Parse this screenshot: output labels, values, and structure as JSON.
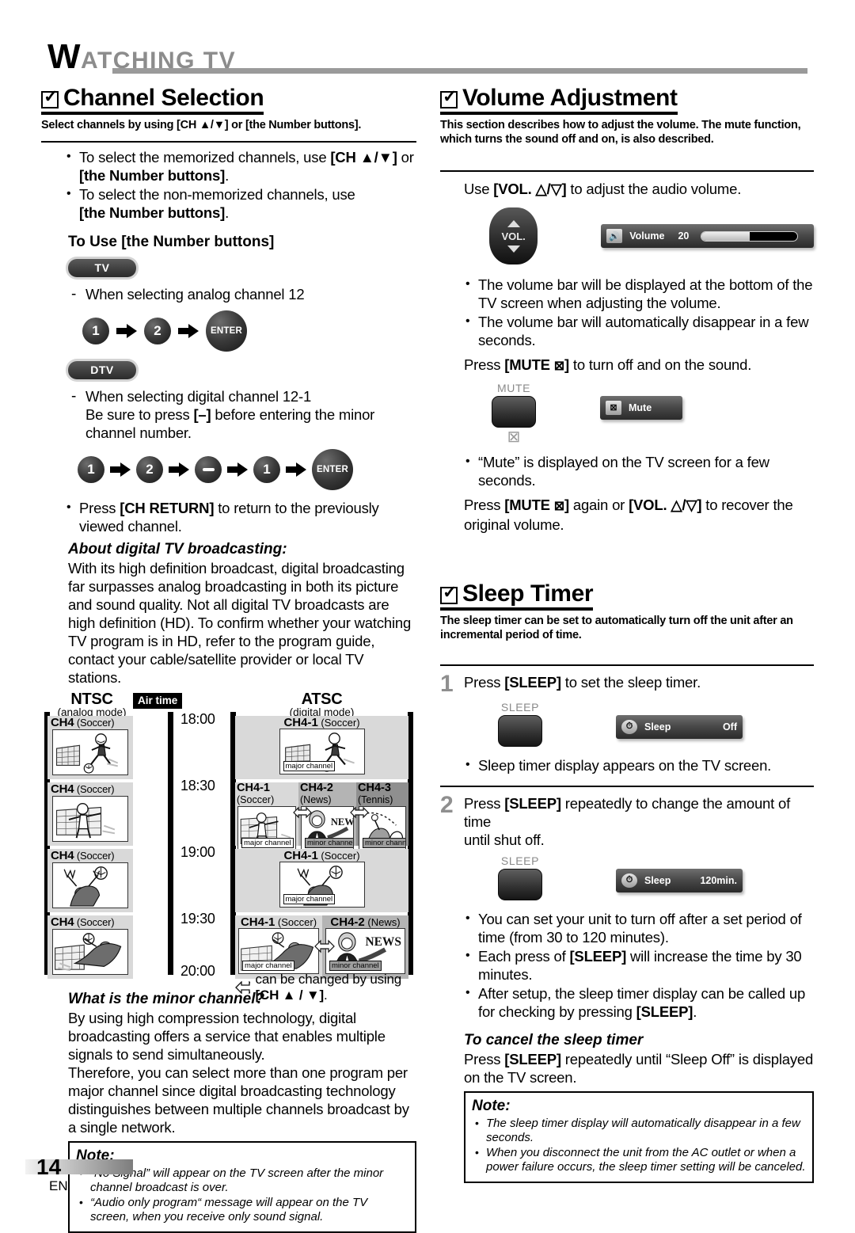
{
  "header": {
    "title_cap": "W",
    "title_rest": "ATCHING TV"
  },
  "footer": {
    "page_number": "14",
    "lang": "EN"
  },
  "channel_selection": {
    "heading": "Channel Selection",
    "subheading": "Select channels by using [CH ▲/▼] or [the Number buttons].",
    "bullets": [
      "To select the memorized channels, use [CH ▲/▼] or [the Number buttons].",
      "To select the non-memorized channels, use [the Number buttons]."
    ],
    "use_number_heading": "To Use [the Number buttons]",
    "tv_pill": "TV",
    "dtv_pill": "DTV",
    "analog_line": "When selecting analog channel 12",
    "analog_keys": [
      "1",
      "2",
      "ENTER"
    ],
    "digital_line_1": "When selecting digital channel 12-1",
    "digital_line_2": "Be sure to press [–] before entering the minor channel number.",
    "digital_keys": [
      "1",
      "2",
      "−",
      "1",
      "ENTER"
    ],
    "ch_return_bullet": "Press [CH RETURN] to return to the previously viewed channel.",
    "about_heading": "About digital TV broadcasting:",
    "about_body": "With its high definition broadcast, digital broadcasting far surpasses analog broadcasting in both its picture and sound quality. Not all digital TV broadcasts are high definition (HD). To confirm whether your watching TV program is in HD, refer to the program guide, contact your cable/satellite provider or local TV stations.",
    "minor_heading": "What is the minor channel?",
    "minor_body_1": "By using high compression technology, digital broadcasting offers a service that enables multiple signals to send simultaneously.",
    "minor_body_2": "Therefore, you can select more than one program per major channel since digital broadcasting technology distinguishes between multiple channels broadcast by a single network.",
    "note": {
      "title": "Note:",
      "items": [
        "“No Signal” will appear on the TV screen after the minor channel broadcast is over.",
        "“Audio only program“ message will appear on the TV screen, when you receive only sound signal."
      ]
    }
  },
  "broadcast_figure": {
    "ntsc_title": "NTSC",
    "ntsc_sub": "(analog mode)",
    "atsc_title": "ATSC",
    "atsc_sub": "(digital mode)",
    "airtime_label": "Air time",
    "times": [
      "18:00",
      "18:30",
      "19:00",
      "19:30",
      "20:00"
    ],
    "ntsc_cells": [
      {
        "ch": "CH4",
        "prog": "(Soccer)"
      },
      {
        "ch": "CH4",
        "prog": "(Soccer)"
      },
      {
        "ch": "CH4",
        "prog": "(Soccer)"
      },
      {
        "ch": "CH4",
        "prog": "(Soccer)"
      }
    ],
    "atsc_rows": [
      {
        "cells": [
          {
            "ch": "CH4-1",
            "prog": "(Soccer)",
            "tag": "major channel"
          }
        ]
      },
      {
        "cells": [
          {
            "ch": "CH4-1",
            "prog": "(Soccer)",
            "tag": "major channel"
          },
          {
            "ch": "CH4-2",
            "prog": "(News)",
            "tag": "minor channel"
          },
          {
            "ch": "CH4-3",
            "prog": "(Tennis)",
            "tag": "minor channel"
          }
        ]
      },
      {
        "cells": [
          {
            "ch": "CH4-1",
            "prog": "(Soccer)",
            "tag": "major channel"
          }
        ]
      },
      {
        "cells": [
          {
            "ch": "CH4-1",
            "prog": "(Soccer)",
            "tag": "major channel"
          },
          {
            "ch": "CH4-2",
            "prog": "(News)",
            "tag": "minor channel"
          }
        ]
      }
    ],
    "legend": "can be changed by using [CH ▲ / ▼]."
  },
  "volume_adjustment": {
    "heading": "Volume Adjustment",
    "subheading": "This section describes how to adjust the volume. The mute function, which turns the sound off and on, is also described.",
    "use_line": "Use [VOL. △/▽] to adjust the audio volume.",
    "vol_key_label": "VOL.",
    "osd_volume": {
      "icon": "speaker-icon",
      "label": "Volume",
      "value": "20",
      "fill_percent": 50
    },
    "bullets": [
      "The volume bar will be displayed at the bottom of the TV screen when adjusting the volume.",
      "The volume bar will automatically disappear in a few seconds."
    ],
    "mute_line": "Press [MUTE ⊠] to turn off and on the sound.",
    "mute_key_caption": "MUTE",
    "osd_mute": {
      "icon": "mute-icon",
      "label": "Mute"
    },
    "mute_bullet": "“Mute” is displayed on the TV screen for a few seconds.",
    "recover_line": "Press [MUTE ⊠] again or [VOL. △/▽] to recover the original volume."
  },
  "sleep_timer": {
    "heading": "Sleep Timer",
    "subheading": "The sleep timer can be set to automatically turn off the unit after an incremental period of time.",
    "step1": {
      "num": "1",
      "text": "Press [SLEEP] to set the sleep timer.",
      "key_caption": "SLEEP",
      "osd": {
        "icon": "clock-icon",
        "label": "Sleep",
        "value": "Off"
      },
      "bullet": "Sleep timer display appears on the TV screen."
    },
    "step2": {
      "num": "2",
      "text": "Press [SLEEP] repeatedly to change the amount of time until shut off.",
      "key_caption": "SLEEP",
      "osd": {
        "icon": "clock-icon",
        "label": "Sleep",
        "value": "120min."
      },
      "bullets": [
        "You can set your unit to turn off after a set period of time (from 30 to 120 minutes).",
        "Each press of [SLEEP] will increase the time by 30 minutes.",
        "After setup, the sleep timer display can be called up for checking by pressing [SLEEP]."
      ]
    },
    "cancel_heading": "To cancel the sleep timer",
    "cancel_body": "Press [SLEEP] repeatedly until “Sleep Off” is displayed on the TV screen.",
    "note": {
      "title": "Note:",
      "items": [
        "The sleep timer display will automatically disappear in a few seconds.",
        "When you disconnect the unit from the AC outlet or when a power failure occurs, the sleep timer setting will be canceled."
      ]
    }
  }
}
